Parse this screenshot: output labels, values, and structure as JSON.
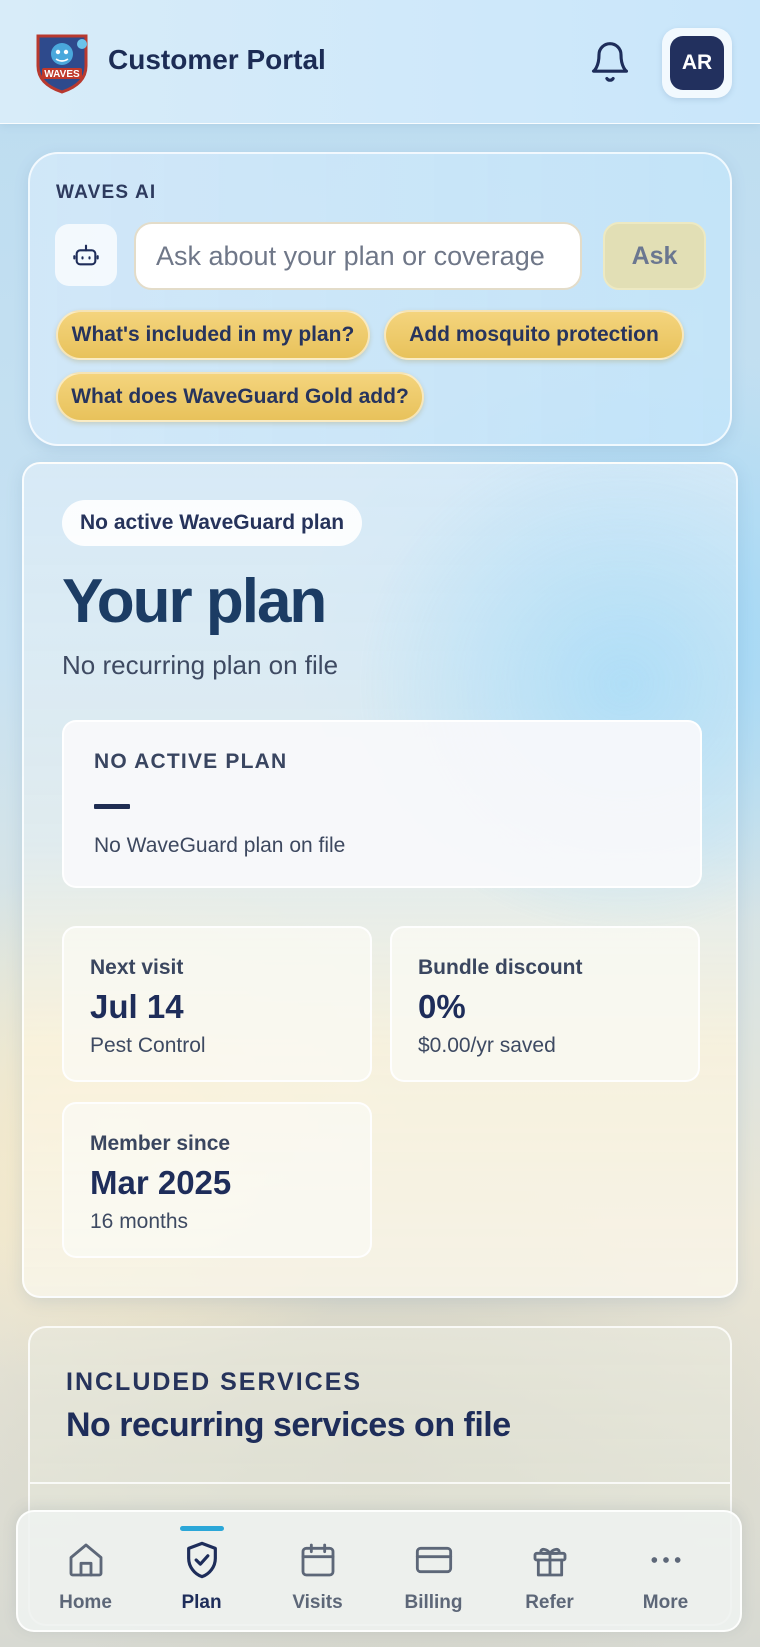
{
  "header": {
    "title": "Customer Portal",
    "logo_text": "WAVES",
    "avatar_initials": "AR",
    "icons": {
      "logo": "waves-logo",
      "notifications": "bell-icon"
    }
  },
  "ai": {
    "label": "WAVES AI",
    "placeholder": "Ask about your plan or coverage",
    "ask_label": "Ask",
    "bot_icon": "robot-icon",
    "suggestions": [
      "What's included in my plan?",
      "Add mosquito protection",
      "What does WaveGuard Gold add?"
    ]
  },
  "plan": {
    "status_badge": "No active WaveGuard plan",
    "title": "Your plan",
    "subtitle": "No recurring plan on file",
    "summary": {
      "label": "NO ACTIVE PLAN",
      "value": "—",
      "description": "No WaveGuard plan on file"
    },
    "stats": [
      {
        "label": "Next visit",
        "value": "Jul 14",
        "sub": "Pest Control"
      },
      {
        "label": "Bundle discount",
        "value": "0%",
        "sub": "$0.00/yr saved"
      },
      {
        "label": "Member since",
        "value": "Mar 2025",
        "sub": "16 months"
      }
    ]
  },
  "services": {
    "label": "INCLUDED SERVICES",
    "title": "No recurring services on file"
  },
  "nav": {
    "active": "Plan",
    "items": [
      {
        "label": "Home",
        "icon": "home-icon"
      },
      {
        "label": "Plan",
        "icon": "shield-check-icon"
      },
      {
        "label": "Visits",
        "icon": "calendar-icon"
      },
      {
        "label": "Billing",
        "icon": "credit-card-icon"
      },
      {
        "label": "Refer",
        "icon": "gift-icon"
      },
      {
        "label": "More",
        "icon": "more-dots-icon"
      }
    ]
  },
  "colors": {
    "navy": "#1f2d52",
    "chip_gold": "#f0cd6e",
    "active_indicator": "#2ba7d8"
  }
}
